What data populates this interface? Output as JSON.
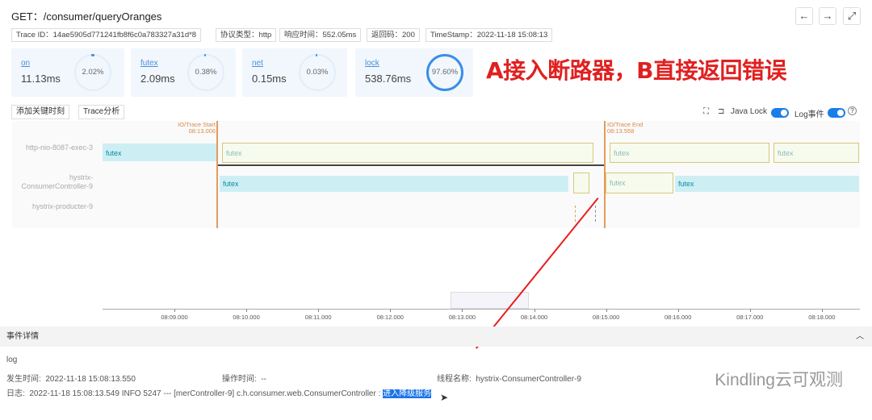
{
  "header": {
    "title": "GET：/consumer/queryOranges",
    "nav": {
      "back": "←",
      "forward": "→",
      "fullscreen": "⤢"
    }
  },
  "tags": [
    "Trace ID：14ae5905d771241fb8f6c0a783327a31d*8",
    "协议类型：http",
    "响应时间：552.05ms",
    "返回码：200",
    "TimeStamp：2022-11-18 15:08:13"
  ],
  "metrics": [
    {
      "label": "on",
      "value": "11.13ms",
      "percent": "2.02%",
      "fraction": 0.0202
    },
    {
      "label": "futex",
      "value": "2.09ms",
      "percent": "0.38%",
      "fraction": 0.0038
    },
    {
      "label": "net",
      "value": "0.15ms",
      "percent": "0.03%",
      "fraction": 0.0003
    },
    {
      "label": "lock",
      "value": "538.76ms",
      "percent": "97.60%",
      "fraction": 0.976
    }
  ],
  "annotation": "A接入断路器，B直接返回错误",
  "toolbar": {
    "add_key_moment": "添加关键时刻",
    "trace_analysis": "Trace分析",
    "java_lock": "Java Lock",
    "log_event": "Log事件",
    "java_lock_on": true,
    "log_event_on": true,
    "help": "?"
  },
  "timeline": {
    "start_marker": {
      "label": "IO/Trace Start",
      "time": "08:13.006"
    },
    "end_marker": {
      "label": "IO/Trace End",
      "time": "08:13.558"
    },
    "lanes": [
      {
        "name": "http-nio-8087-exec-3",
        "spans": [
          "futex",
          "futex",
          "futex",
          "futex"
        ]
      },
      {
        "name": "hystrix-ConsumerController-9",
        "spans": [
          "futex",
          "futex",
          "futex"
        ]
      },
      {
        "name": "hystrix-producter-9",
        "spans": []
      }
    ],
    "ticks": [
      "08:09.000",
      "08:10.000",
      "08:11.000",
      "08:12.000",
      "08:13.000",
      "08:14.000",
      "08:15.000",
      "08:16.000",
      "08:17.000",
      "08:18.000"
    ]
  },
  "details": {
    "title": "事件详情",
    "collapse": "︿",
    "type": "log",
    "occur_time_label": "发生时间:",
    "occur_time": "2022-11-18 15:08:13.550",
    "op_time_label": "操作时间:",
    "op_time": "--",
    "thread_label": "线程名称:",
    "thread": "hystrix-ConsumerController-9",
    "log_label": "日志:",
    "log_text": "2022-11-18 15:08:13.549 INFO 5247 --- [merController-9] c.h.consumer.web.ConsumerController :",
    "log_highlight": "进入降级服务"
  },
  "watermark": "Kindling云可观测"
}
